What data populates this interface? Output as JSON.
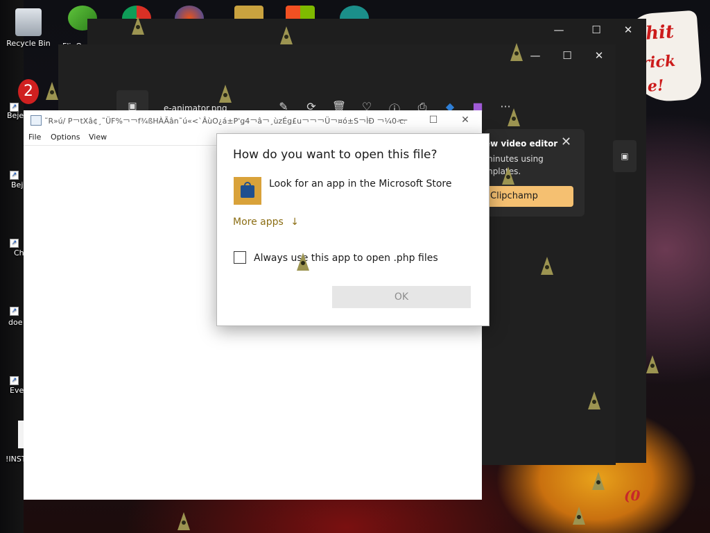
{
  "desktop": {
    "recycle_bin_label": "Recycle Bin",
    "shortcut_labels": [
      "Beje D",
      "Beje D",
      "Ch D",
      "doe",
      "Eve",
      "!INST"
    ],
    "partial_label_top": "Fli. O",
    "meme_text": [
      "shit",
      "rick",
      "e!"
    ],
    "wallpaper_text": "(0"
  },
  "photos_back": {
    "minimize_icon": "—",
    "maximize_icon": "☐",
    "close_icon": "✕"
  },
  "photos_front": {
    "minimize_icon": "—",
    "maximize_icon": "☐",
    "close_icon": "✕",
    "file_title": "e-animator.png",
    "toolbar_icons": [
      "edit",
      "rotate",
      "delete",
      "favorite",
      "info",
      "print",
      "clipchamp",
      "paint",
      "more"
    ],
    "more_icon": "···"
  },
  "promo": {
    "title": "ew video editor",
    "body": "minutes using mplates.",
    "button_label": "Clipchamp",
    "close_icon": "✕"
  },
  "notepad": {
    "title": "˜R»ú/  P￢tXâ¢¸˜ÜF%￢￢f¾ßHÀÃân˜ú«<`ÂùO¿á±P'g4￢â￢¸ùzÉg£u￢￢￢Ü￢¤ó±S￢ÌÐ  ￢¼0-c£e...",
    "menu": [
      "File",
      "Options",
      "View"
    ],
    "minimize_icon": "—",
    "maximize_icon": "☐",
    "close_icon": "✕"
  },
  "dialog": {
    "heading": "How do you want to open this file?",
    "store_option": "Look for an app in the Microsoft Store",
    "more_apps": "More apps",
    "more_apps_arrow": "↓",
    "always_use": "Always use this app to open .php files",
    "always_use_checked": false,
    "ok_label": "OK",
    "ok_enabled": false
  },
  "colors": {
    "accent_link": "#8b6d13",
    "clipchamp_button": "#f5c071",
    "store_tile": "#d9a23a"
  }
}
